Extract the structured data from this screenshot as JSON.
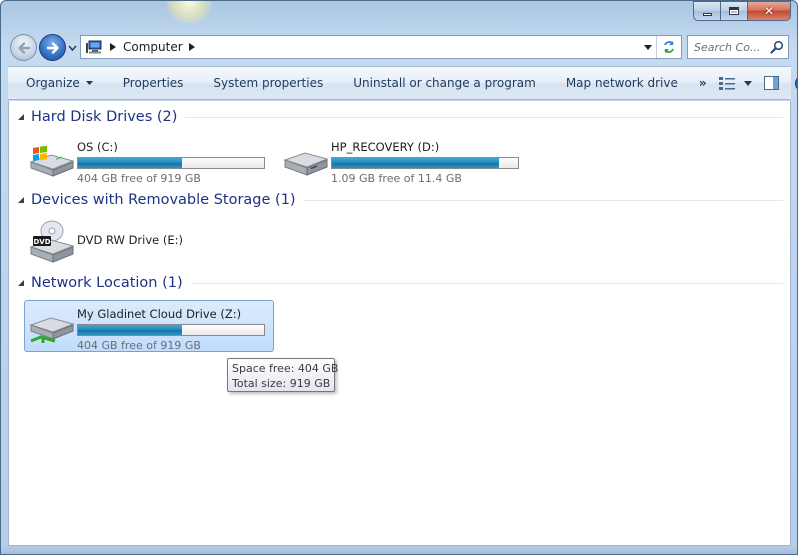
{
  "window": {
    "colors": {
      "accent": "#1e3287",
      "bar_fill": "#2689bd",
      "selection": "#c1dcfc"
    }
  },
  "caption": {
    "close_glyph": "✕"
  },
  "address_bar": {
    "location": "Computer",
    "icon": "computer-icon"
  },
  "search": {
    "placeholder": "Search Co..."
  },
  "command_bar": {
    "organize": "Organize",
    "properties": "Properties",
    "system_properties": "System properties",
    "uninstall": "Uninstall or change a program",
    "map_network": "Map network drive",
    "more": "»"
  },
  "groups": [
    {
      "title": "Hard Disk Drives (2)",
      "drives": [
        {
          "name": "OS (C:)",
          "free_text": "404 GB free of 919 GB",
          "used_fraction": 0.56,
          "icon": "windows-drive-icon"
        },
        {
          "name": "HP_RECOVERY (D:)",
          "free_text": "1.09 GB free of 11.4 GB",
          "used_fraction": 0.9,
          "icon": "hard-drive-icon"
        }
      ]
    },
    {
      "title": "Devices with Removable Storage (1)",
      "drives": [
        {
          "name": "DVD RW Drive (E:)",
          "icon": "dvd-drive-icon",
          "label": "DVD"
        }
      ]
    },
    {
      "title": "Network Location (1)",
      "drives": [
        {
          "name": "My Gladinet Cloud Drive (Z:)",
          "free_text": "404 GB free of 919 GB",
          "used_fraction": 0.56,
          "icon": "network-drive-icon"
        }
      ]
    }
  ],
  "tooltip": {
    "space_free": "Space free: 404 GB",
    "total_size": "Total size: 919 GB"
  }
}
